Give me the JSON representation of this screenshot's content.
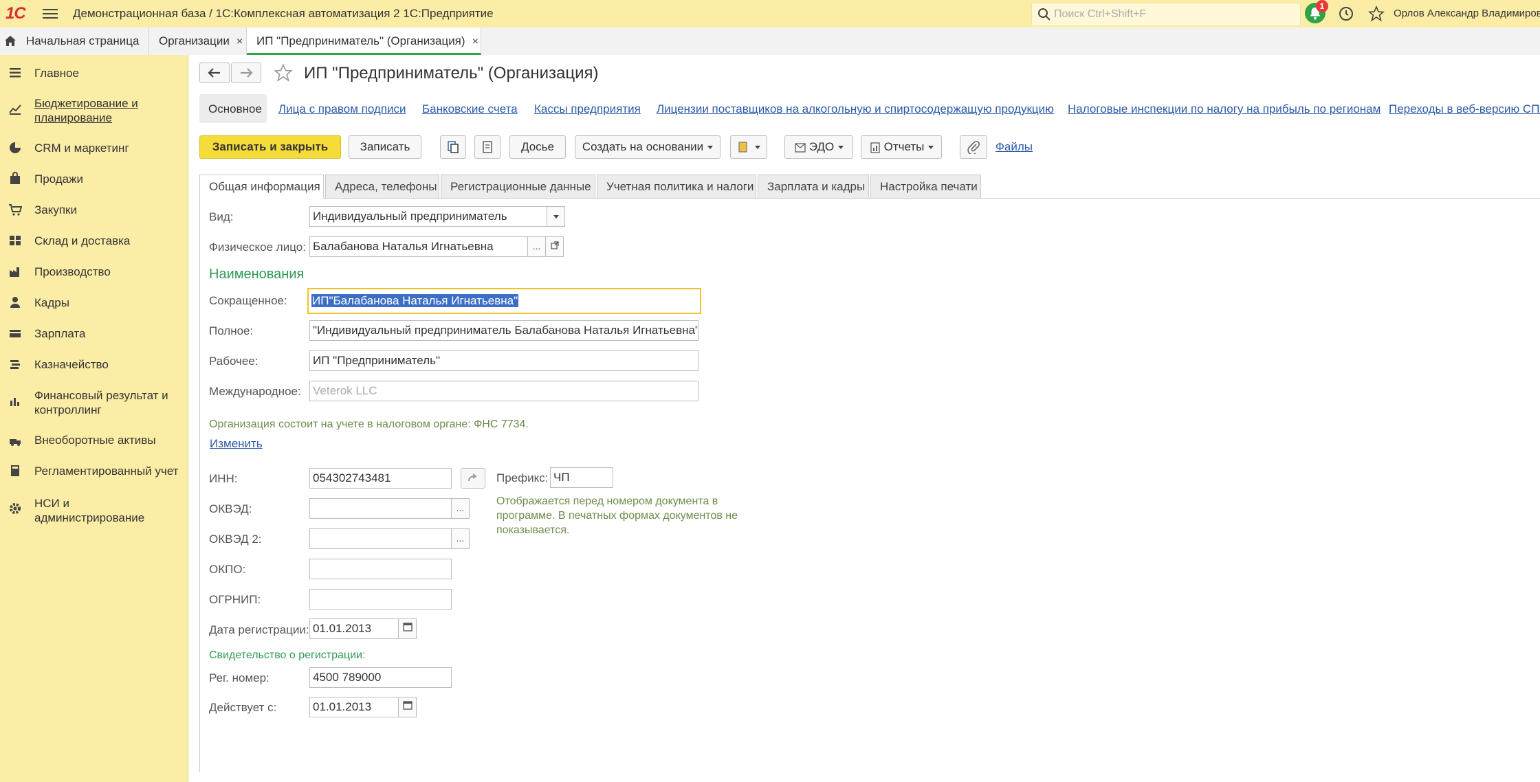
{
  "app": {
    "logo_text": "1С",
    "title": "Демонстрационная база / 1С:Комплексная автоматизация 2 1С:Предприятие",
    "search_placeholder": "Поиск Ctrl+Shift+F",
    "notifications_count": "1",
    "user_name": "Орлов Александр Владимирович"
  },
  "window_tabs": [
    {
      "label": "Начальная страница"
    },
    {
      "label": "Организации",
      "close": "×"
    },
    {
      "label": "ИП \"Предприниматель\" (Организация)",
      "close": "×"
    }
  ],
  "sidebar": {
    "items": [
      {
        "label": "Главное",
        "icon": "menu-icon"
      },
      {
        "label": "Бюджетирование и планирование",
        "icon": "budget-icon"
      },
      {
        "label": "CRM и маркетинг",
        "icon": "pie-chart-icon"
      },
      {
        "label": "Продажи",
        "icon": "bag-icon"
      },
      {
        "label": "Закупки",
        "icon": "cart-icon"
      },
      {
        "label": "Склад и доставка",
        "icon": "warehouse-icon"
      },
      {
        "label": "Производство",
        "icon": "factory-icon"
      },
      {
        "label": "Кадры",
        "icon": "person-icon"
      },
      {
        "label": "Зарплата",
        "icon": "wallet-icon"
      },
      {
        "label": "Казначейство",
        "icon": "coins-icon"
      },
      {
        "label": "Финансовый результат и контроллинг",
        "icon": "bar-chart-icon"
      },
      {
        "label": "Внеоборотные активы",
        "icon": "assets-icon"
      },
      {
        "label": "Регламентированный учет",
        "icon": "calculator-icon"
      },
      {
        "label": "НСИ и администрирование",
        "icon": "gear-icon"
      }
    ]
  },
  "form": {
    "title": "ИП \"Предприниматель\" (Организация)",
    "nav_links": [
      "Основное",
      "Лица с правом подписи",
      "Банковские счета",
      "Кассы предприятия",
      "Лицензии поставщиков на алкогольную и спиртосодержащую продукцию",
      "Налоговые инспекции по налогу на прибыль по регионам",
      "Переходы в веб-версию СП..."
    ],
    "toolbar": {
      "save_close": "Записать и закрыть",
      "save": "Записать",
      "dossier": "Досье",
      "create_based": "Создать на основании",
      "edo": "ЭДО",
      "reports": "Отчеты",
      "files": "Файлы"
    },
    "tabs": [
      "Общая информация",
      "Адреса, телефоны",
      "Регистрационные данные",
      "Учетная политика и налоги",
      "Зарплата и кадры",
      "Настройка печати"
    ],
    "fields": {
      "vid_label": "Вид:",
      "vid_value": "Индивидуальный предприниматель",
      "person_label": "Физическое лицо:",
      "person_value": "Балабанова Наталья Игнатьевна",
      "names_section": "Наименования",
      "short_label": "Сокращенное:",
      "short_value": "ИП\"Балабанова Наталья Игнатьевна\"",
      "full_label": "Полное:",
      "full_value": "\"Индивидуальный предприниматель Балабанова Наталья Игнатьевна\"",
      "work_label": "Рабочее:",
      "work_value": "ИП \"Предприниматель\"",
      "intl_label": "Международное:",
      "intl_placeholder": "Veterok LLC",
      "tax_note": "Организация состоит на учете в налоговом органе: ФНС 7734.",
      "change_link": "Изменить",
      "inn_label": "ИНН:",
      "inn_value": "054302743481",
      "prefix_label": "Префикс:",
      "prefix_value": "ЧП",
      "prefix_note": "Отображается перед номером документа в программе. В печатных формах документов не показывается.",
      "okved_label": "ОКВЭД:",
      "okved_value": "",
      "okved2_label": "ОКВЭД 2:",
      "okved2_value": "",
      "okpo_label": "ОКПО:",
      "okpo_value": "",
      "ogrnip_label": "ОГРНИП:",
      "ogrnip_value": "",
      "regdate_label": "Дата регистрации:",
      "regdate_value": "01.01.2013",
      "cert_section": "Свидетельство о регистрации:",
      "regnum_label": "Рег. номер:",
      "regnum_value": "4500 789000",
      "valid_label": "Действует с:",
      "valid_value": "01.01.2013"
    }
  },
  "colors": {
    "sidebar_bg": "#fbeda6",
    "primary_button": "#f6dc3a",
    "link": "#2a5ba9",
    "section_green": "#2f9a56",
    "active_tab_accent": "#2fa348"
  }
}
